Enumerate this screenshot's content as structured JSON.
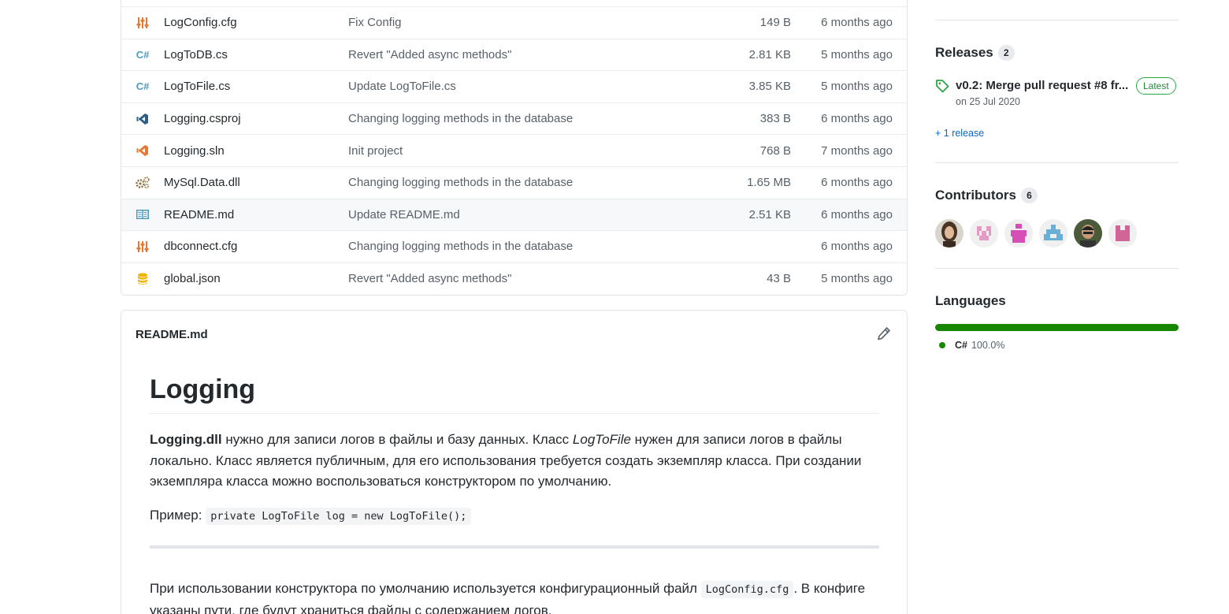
{
  "files": [
    {
      "icon": "config-icon",
      "name": "LogConfig.cfg",
      "message": "Fix Config",
      "size": "149 B",
      "age": "6 months ago"
    },
    {
      "icon": "csharp-icon",
      "name": "LogToDB.cs",
      "message": "Revert \"Added async methods\"",
      "size": "2.81 KB",
      "age": "5 months ago"
    },
    {
      "icon": "csharp-icon",
      "name": "LogToFile.cs",
      "message": "Update LogToFile.cs",
      "size": "3.85 KB",
      "age": "5 months ago"
    },
    {
      "icon": "visual-studio-icon",
      "name": "Logging.csproj",
      "message": "Changing logging methods in the database",
      "size": "383 B",
      "age": "6 months ago"
    },
    {
      "icon": "visual-studio-icon",
      "name": "Logging.sln",
      "message": "Init project",
      "size": "768 B",
      "age": "7 months ago"
    },
    {
      "icon": "gears-icon",
      "name": "MySql.Data.dll",
      "message": "Changing logging methods in the database",
      "size": "1.65 MB",
      "age": "6 months ago"
    },
    {
      "icon": "book-icon",
      "name": "README.md",
      "message": "Update README.md",
      "size": "2.51 KB",
      "age": "6 months ago"
    },
    {
      "icon": "config-icon",
      "name": "dbconnect.cfg",
      "message": "Changing logging methods in the database",
      "size": "",
      "age": "6 months ago"
    },
    {
      "icon": "database-icon",
      "name": "global.json",
      "message": "Revert \"Added async methods\"",
      "size": "43 B",
      "age": "5 months ago"
    }
  ],
  "readme": {
    "filename": "README.md",
    "heading": "Logging",
    "p1_bold": "Logging.dll",
    "p1_text1": " нужно для записи логов в файлы и базу данных. Класс ",
    "p1_italic": "LogToFile",
    "p1_text2": " нужен для записи логов в файлы локально. Класс является публичным, для его использования требуется создать экземпляр класса. При создании экземпляра класса можно воспользоваться конструктором по умолчанию.",
    "p2_label": "Пример: ",
    "p2_code": "private LogToFile log = new LogToFile();",
    "p3_text1": "При использовании конструктора по умолчанию используется конфигурационный файл ",
    "p3_code": "LogConfig.cfg",
    "p3_text2": ". В конфиге указаны пути, где будут храниться файлы с содержанием логов."
  },
  "sidebar": {
    "releases": {
      "title": "Releases",
      "count": "2",
      "latest_name": "v0.2: Merge pull request #8 fr...",
      "latest_badge": "Latest",
      "latest_date": "on 25 Jul 2020",
      "more_link": "+ 1 release"
    },
    "contributors": {
      "title": "Contributors",
      "count": "6"
    },
    "languages": {
      "title": "Languages",
      "items": [
        {
          "name": "C#",
          "percent": "100.0%",
          "color": "#178600"
        }
      ]
    }
  }
}
